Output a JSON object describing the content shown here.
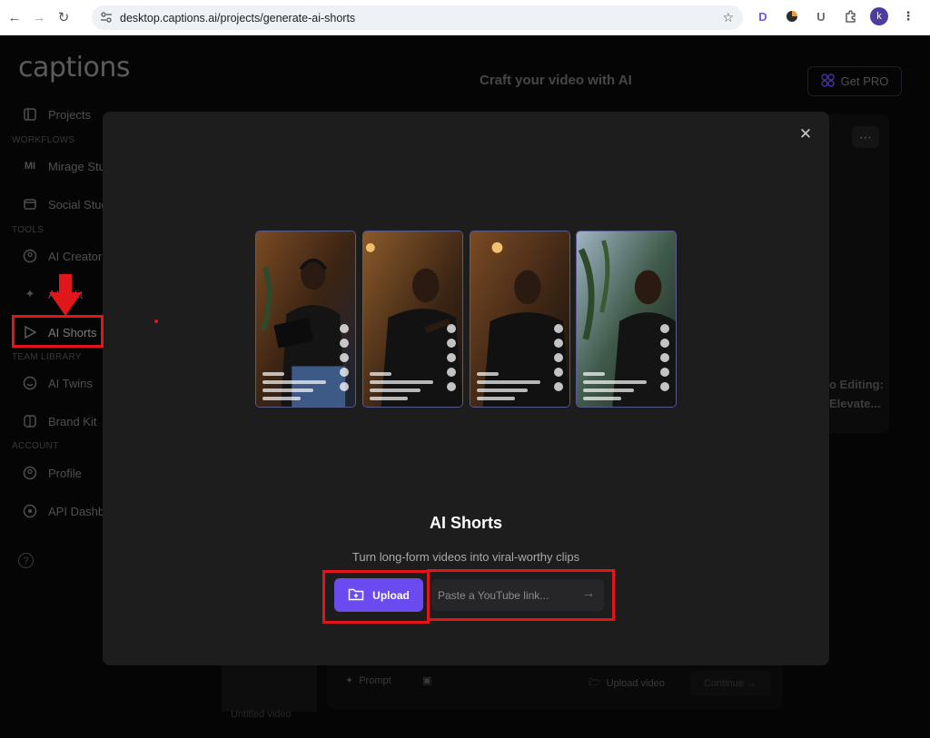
{
  "browser": {
    "url": "desktop.captions.ai/projects/generate-ai-shorts",
    "profile_initial": "k"
  },
  "app": {
    "logo": "captions",
    "page_title": "Craft your video with AI",
    "get_pro_label": "Get PRO"
  },
  "sidebar": {
    "projects": "Projects",
    "workflows_label": "WORKFLOWS",
    "mirage_studio": "Mirage Stu",
    "social_studio": "Social Stud",
    "tools_label": "TOOLS",
    "ai_creator": "AI Creator",
    "ai_edit": "AI Edit",
    "ai_shorts": "AI Shorts",
    "team_library_label": "TEAM LIBRARY",
    "ai_twins": "AI Twins",
    "brand_kit": "Brand Kit",
    "account_label": "ACCOUNT",
    "profile": "Profile",
    "api_dashboard": "API Dashb"
  },
  "background": {
    "card_text_1": "o Editing:",
    "card_text_2": "Elevate...",
    "composer": {
      "prompt_label": "Prompt",
      "upload_video_label": "Upload video",
      "continue_label": "Continue",
      "thumb_label": "Untitled video"
    }
  },
  "modal": {
    "title": "AI Shorts",
    "subtitle": "Turn long-form videos into viral-worthy clips",
    "upload_label": "Upload",
    "youtube_placeholder": "Paste a YouTube link..."
  },
  "colors": {
    "accent": "#6b4bf0",
    "modal_bg": "#1d1d1e",
    "annotation_red": "#e0161b"
  }
}
